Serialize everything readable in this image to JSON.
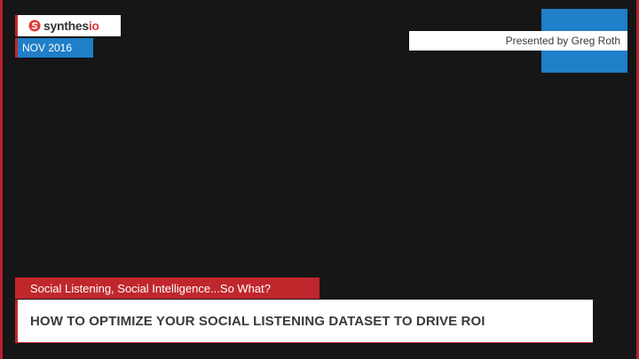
{
  "logo": {
    "text_main": "synthes",
    "text_accent": "io",
    "icon": "synthesio-s-logo-icon"
  },
  "date": "NOV 2016",
  "presenter": "Presented by Greg Roth",
  "subtitle": "Social Listening, Social Intelligence...So What?",
  "title": "HOW TO OPTIMIZE YOUR SOCIAL LISTENING DATASET TO DRIVE ROI",
  "colors": {
    "brand_red": "#c0272d",
    "accent_blue": "#1f7fc8",
    "background": "#161616"
  }
}
